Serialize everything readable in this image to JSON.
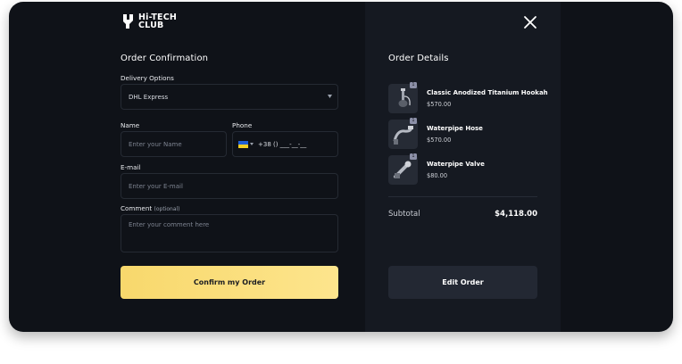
{
  "brand": {
    "line1": "Hi-TECH",
    "line2": "CLUB"
  },
  "form": {
    "title": "Order Confirmation",
    "delivery": {
      "label": "Delivery Options",
      "value": "DHL Express"
    },
    "name": {
      "label": "Name",
      "placeholder": "Enter your Name"
    },
    "phone": {
      "label": "Phone",
      "value": "+38 () ___-__-__"
    },
    "email": {
      "label": "E-mail",
      "placeholder": "Enter your E-mail"
    },
    "comment": {
      "label": "Comment",
      "optional": "(optional)",
      "placeholder": "Enter your comment here"
    },
    "confirm_label": "Confirm my Order"
  },
  "details": {
    "title": "Order Details",
    "items": [
      {
        "name": "Classic Anodized Titanium Hookah",
        "price": "$570.00",
        "qty": "1",
        "icon": "hookah-icon"
      },
      {
        "name": "Waterpipe Hose",
        "price": "$570.00",
        "qty": "1",
        "icon": "hose-icon"
      },
      {
        "name": "Waterpipe Valve",
        "price": "$80.00",
        "qty": "1",
        "icon": "valve-icon"
      }
    ],
    "subtotal_label": "Subtotal",
    "subtotal_value": "$4,118.00",
    "edit_label": "Edit Order"
  },
  "colors": {
    "accent": "#fbdf7e",
    "panel": "#0f1218",
    "panel_alt": "#151921"
  }
}
